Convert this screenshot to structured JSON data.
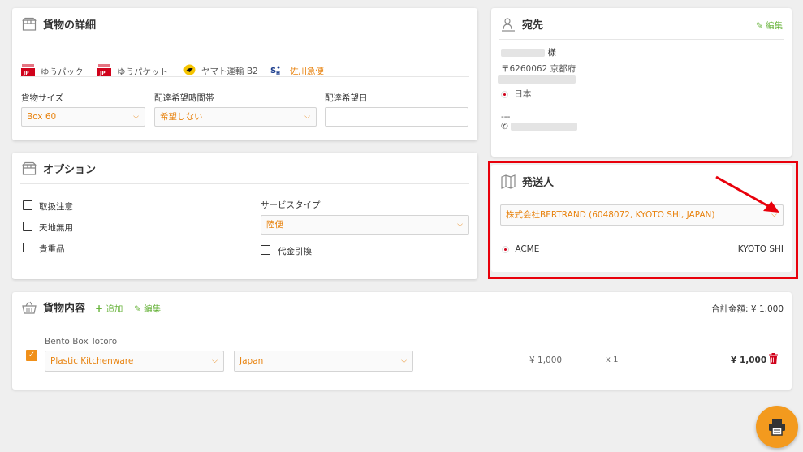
{
  "cargo_details": {
    "title": "貨物の詳細",
    "carriers": [
      {
        "name": "ゆうパック",
        "logo": "yu-pack-logo",
        "active": false
      },
      {
        "name": "ゆうパケット",
        "logo": "yu-packet-logo",
        "active": false
      },
      {
        "name": "ヤマト運輸 B2",
        "logo": "yamato-logo",
        "active": false
      },
      {
        "name": "佐川急便",
        "logo": "sagawa-logo",
        "active": true
      }
    ],
    "size_label": "貨物サイズ",
    "size_value": "Box 60",
    "time_label": "配達希望時間帯",
    "time_value": "希望しない",
    "date_label": "配達希望日",
    "date_value": ""
  },
  "options": {
    "title": "オプション",
    "checkboxes": [
      "取扱注意",
      "天地無用",
      "貴重品"
    ],
    "service_type_label": "サービスタイプ",
    "service_type_value": "陸便",
    "cod_label": "代金引換"
  },
  "recipient": {
    "title": "宛先",
    "edit_label": "編集",
    "honorific": "様",
    "postal": "〒6260062",
    "prefecture": "京都府",
    "country": "日本",
    "separator": "---"
  },
  "sender": {
    "title": "発送人",
    "select_value": "株式会社BERTRAND (6048072, KYOTO SHI, JAPAN)",
    "company": "ACME",
    "city": "KYOTO SHI"
  },
  "contents": {
    "title": "貨物内容",
    "add_label": "追加",
    "edit_label": "編集",
    "total_label": "合計金額: ¥ 1,000",
    "item": {
      "name": "Bento Box Totoro",
      "category": "Plastic Kitchenware",
      "origin": "Japan",
      "unit_price": "¥ 1,000",
      "quantity": "x 1",
      "line_total": "¥ 1,000",
      "checked": true
    }
  },
  "colors": {
    "accent": "#e8830f",
    "green": "#6ab43e",
    "highlight": "#e8000b",
    "print_button": "#f39a1e"
  }
}
